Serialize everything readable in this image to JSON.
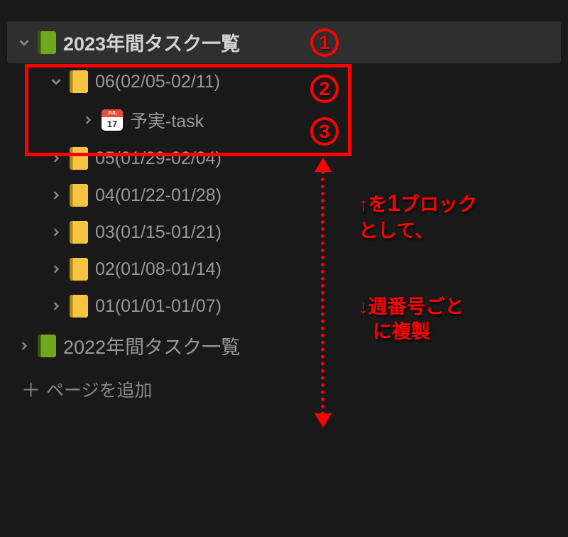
{
  "sidebar": {
    "root": {
      "label": "2023年間タスク一覧"
    },
    "weeks": [
      {
        "label": "06(02/05-02/11)",
        "expanded": true
      },
      {
        "label": "05(01/29-02/04)",
        "expanded": false
      },
      {
        "label": "04(01/22-01/28)",
        "expanded": false
      },
      {
        "label": "03(01/15-01/21)",
        "expanded": false
      },
      {
        "label": "02(01/08-01/14)",
        "expanded": false
      },
      {
        "label": "01(01/01-01/07)",
        "expanded": false
      }
    ],
    "task": {
      "label": "予実-task",
      "cal_month": "JUL",
      "cal_day": "17"
    },
    "prev_year": {
      "label": "2022年間タスク一覧"
    },
    "add_page": "ページを追加"
  },
  "annotations": {
    "c1": "1",
    "c2": "2",
    "c3": "3",
    "text1a": "↑を",
    "text1b": "1",
    "text1c": "ブロック",
    "text1d": "として、",
    "text2": "↓週番号ごと",
    "text3": "に複製"
  }
}
